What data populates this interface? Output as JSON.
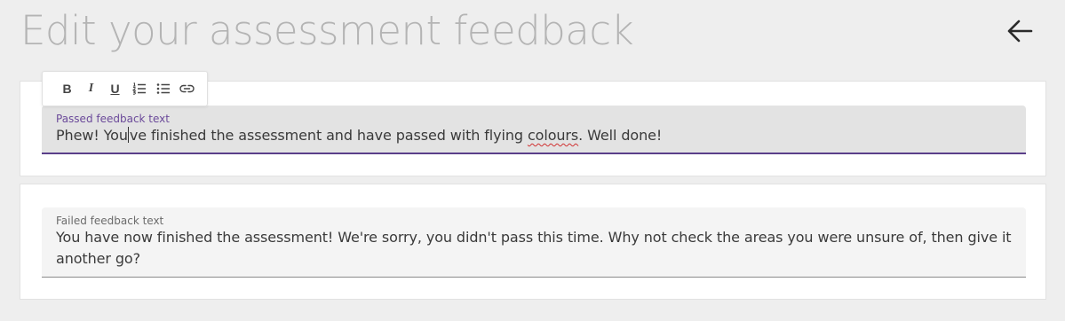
{
  "page": {
    "title": "Edit your assessment feedback"
  },
  "toolbar": {
    "bold": "B",
    "italic": "I",
    "underline": "U"
  },
  "passed": {
    "label": "Passed feedback text",
    "value_before_caret": "Phew! You",
    "value_after_caret": "ve finished the assessment and have passed with flying ",
    "misspelled": "colours",
    "value_end": ". Well done!"
  },
  "failed": {
    "label": "Failed feedback text",
    "value": "You have now finished the assessment! We're sorry, you didn't pass this time. Why not check the areas you were unsure of, then give it another go?"
  },
  "colors": {
    "background": "#eeeeee",
    "accent": "#5a3f8a",
    "title": "#b4b4b4"
  },
  "icons": [
    "arrow-left-icon",
    "numbered-list-icon",
    "bulleted-list-icon",
    "link-icon"
  ]
}
